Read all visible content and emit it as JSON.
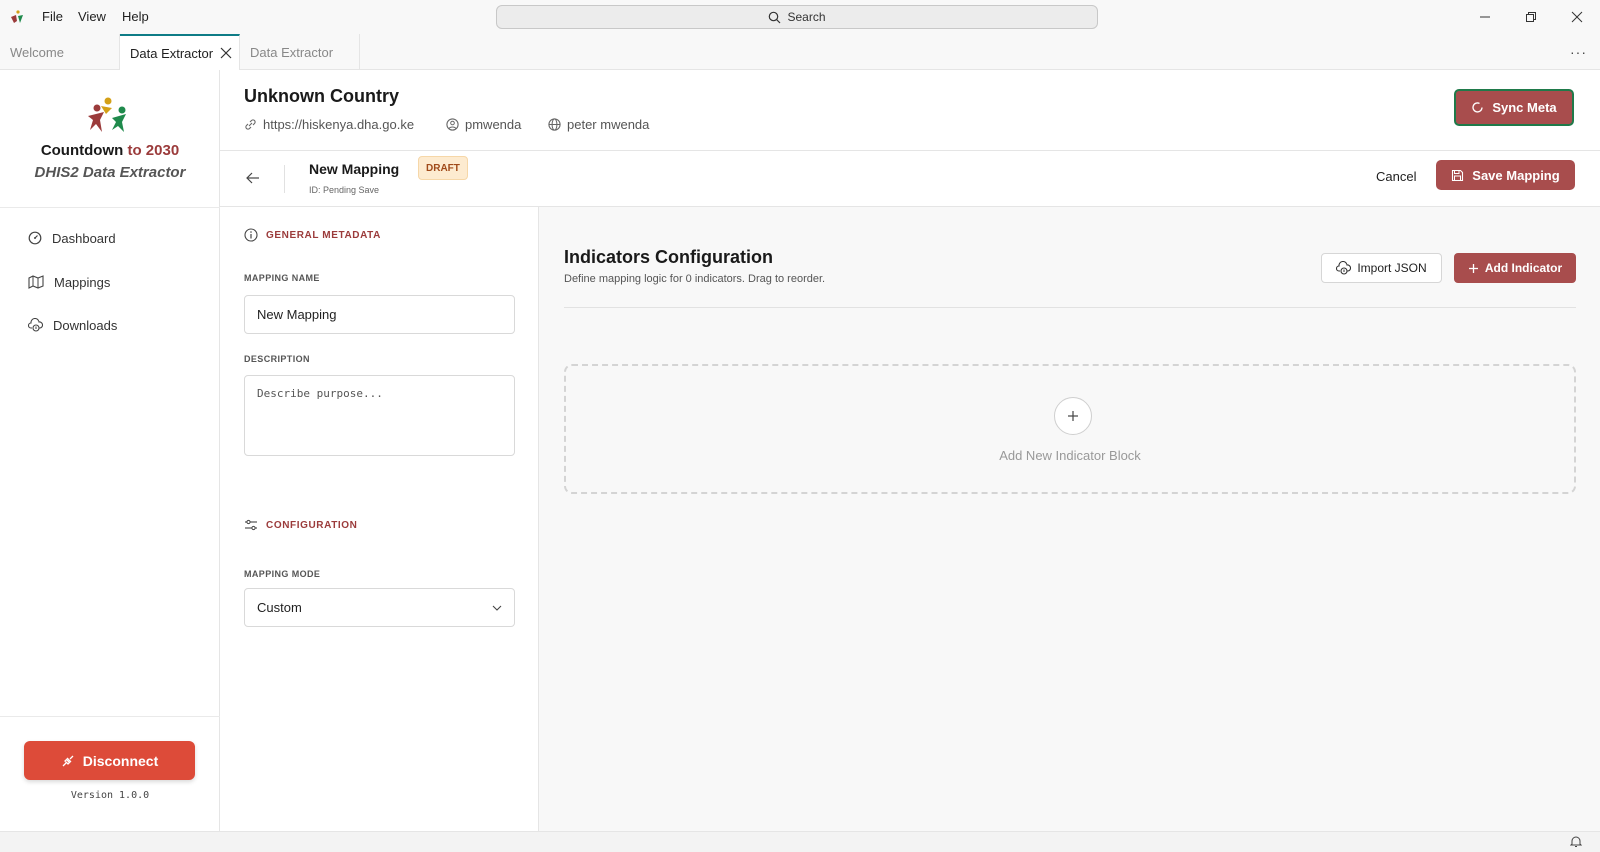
{
  "titlebar": {
    "menus": [
      "File",
      "View",
      "Help"
    ],
    "search_label": "Search"
  },
  "tabs": [
    {
      "label": "Welcome",
      "active": false
    },
    {
      "label": "Data Extractor",
      "active": true
    },
    {
      "label": "Data Extractor",
      "active": false
    }
  ],
  "sidebar": {
    "brand_line1_a": "Countdown",
    "brand_line1_b": "to 2030",
    "brand_line2": "DHIS2 Data Extractor",
    "items": [
      {
        "label": "Dashboard",
        "icon": "gauge-icon"
      },
      {
        "label": "Mappings",
        "icon": "map-icon"
      },
      {
        "label": "Downloads",
        "icon": "cloud-download-icon"
      }
    ],
    "disconnect_label": "Disconnect",
    "version": "Version 1.0.0"
  },
  "header": {
    "country": "Unknown Country",
    "url": "https://hiskenya.dha.go.ke",
    "username": "pmwenda",
    "fullname": "peter mwenda",
    "sync_label": "Sync Meta"
  },
  "subheader": {
    "title": "New Mapping",
    "badge": "DRAFT",
    "id_text": "ID: Pending Save",
    "cancel_label": "Cancel",
    "save_label": "Save Mapping"
  },
  "form": {
    "general_title": "GENERAL METADATA",
    "name_label": "MAPPING NAME",
    "name_value": "New Mapping",
    "desc_label": "DESCRIPTION",
    "desc_placeholder": "Describe purpose...",
    "config_title": "CONFIGURATION",
    "mode_label": "MAPPING MODE",
    "mode_value": "Custom"
  },
  "main": {
    "title": "Indicators Configuration",
    "subtitle": "Define mapping logic for 0 indicators. Drag to reorder.",
    "import_label": "Import JSON",
    "add_label": "Add Indicator",
    "add_block_label": "Add New Indicator Block"
  },
  "colors": {
    "brand": "#a84d4d",
    "danger": "#dd4b39",
    "tab_accent": "#0e7c86"
  }
}
